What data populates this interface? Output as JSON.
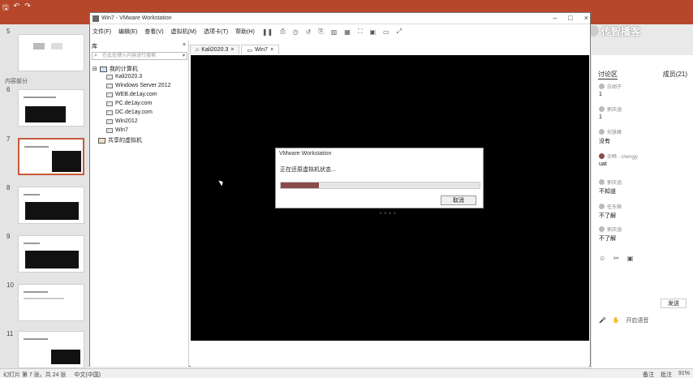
{
  "ppt": {
    "sections": [
      "内容部分"
    ],
    "slide_numbers": [
      "5",
      "6",
      "7",
      "8",
      "9",
      "10",
      "11"
    ],
    "status_left": [
      "幻灯片 第 7 张，共 24 张",
      "中文(中国)"
    ],
    "status_right": [
      "备注",
      "批注",
      "91%"
    ]
  },
  "vm": {
    "title": "Win7 - VMware Workstation",
    "menu": [
      "文件(F)",
      "编辑(E)",
      "查看(V)",
      "虚拟机(M)",
      "选项卡(T)",
      "帮助(H)"
    ],
    "library": {
      "title": "库",
      "search_placeholder": "在此处键入内容进行搜索",
      "root": "我的计算机",
      "vms": [
        "Kali2020.3",
        "Windows Server 2012",
        "WEB.de1ay.com",
        "PC.de1ay.com",
        "DC.de1ay.com",
        "Win2012",
        "Win7"
      ],
      "shared": "共享的虚拟机"
    },
    "tabs": [
      "Kali2020.3",
      "Win7"
    ]
  },
  "dialog": {
    "title": "VMware Workstation",
    "message": "正在还原虚拟机状态...",
    "progress": 0.19,
    "cancel_label": "取消"
  },
  "chat": {
    "tab_discussion": "讨论区",
    "tab_members": "成员(21)",
    "messages": [
      {
        "name": "白胡子",
        "text": "1"
      },
      {
        "name": "郭庆涵",
        "text": "1"
      },
      {
        "name": "何慧峰",
        "text": "没有"
      },
      {
        "name": "余韩 · chengjy",
        "text": "uat"
      },
      {
        "name": "郭庆涵",
        "text": "不知道"
      },
      {
        "name": "任东楠",
        "text": "不了解"
      },
      {
        "name": "郭庆涵",
        "text": "不了解"
      }
    ],
    "send_label": "发送",
    "bottom_text": "开启语音"
  },
  "watermark": "传智播客"
}
